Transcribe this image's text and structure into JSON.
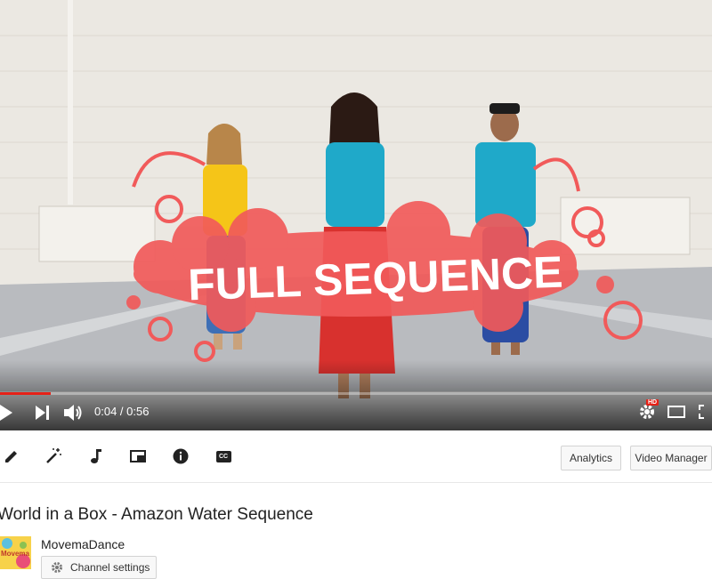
{
  "video": {
    "overlay_text": "FULL SEQUENCE",
    "time_current": "0:04",
    "time_separator": " / ",
    "time_total": "0:56",
    "progress_fraction": 0.071,
    "hd_badge": "HD",
    "accent_color": "#e62117",
    "overlay_color": "#f15a5a"
  },
  "player_controls": {
    "play_icon": "play-icon",
    "next_icon": "next-icon",
    "volume_icon": "volume-icon",
    "settings_icon": "gear-icon",
    "theater_icon": "theater-icon",
    "fullscreen_icon": "fullscreen-icon"
  },
  "toolbar": {
    "tools": [
      "pencil-icon",
      "magic-wand-icon",
      "music-note-icon",
      "card-icon",
      "info-icon",
      "cc-icon"
    ],
    "cc_label": "CC",
    "analytics_label": "Analytics",
    "video_manager_label": "Video Manager"
  },
  "info": {
    "title": "World in a Box - Amazon Water Sequence",
    "channel_name": "MovemaDance",
    "channel_settings_label": "Channel settings",
    "avatar_text": "Movema"
  }
}
